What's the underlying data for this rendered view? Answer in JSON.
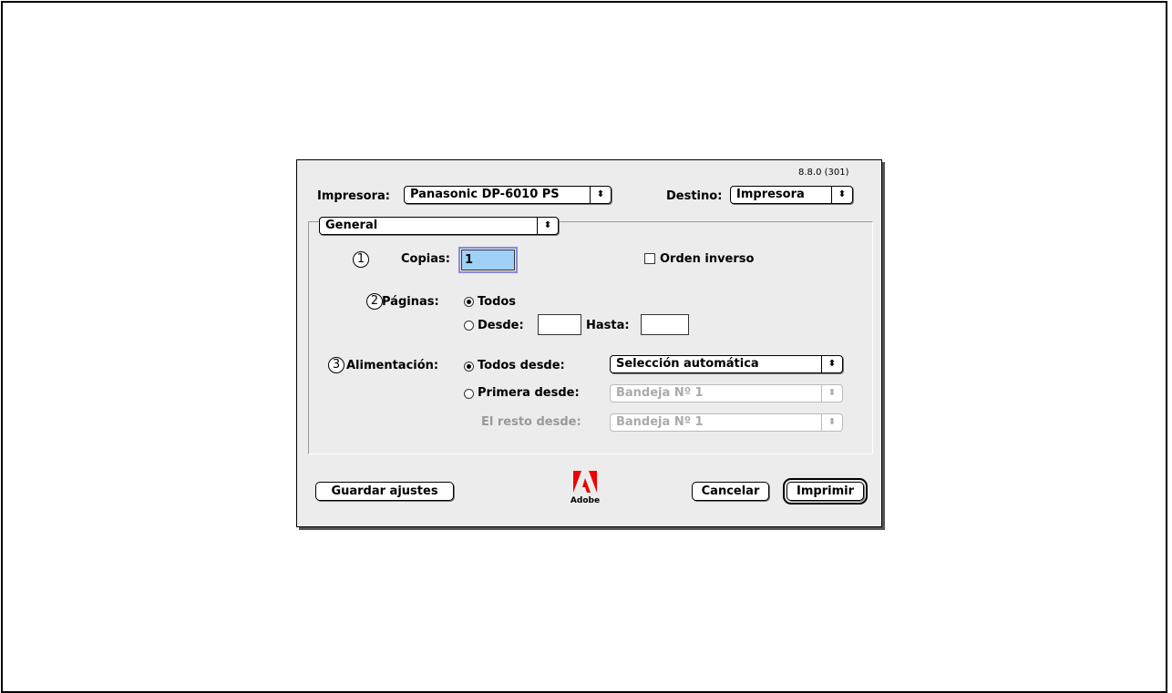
{
  "version": "8.8.0 (301)",
  "printer": {
    "label": "Impresora:",
    "value": "Panasonic DP-6010 PS"
  },
  "destination": {
    "label": "Destino:",
    "value": "Impresora"
  },
  "panel": {
    "value": "General"
  },
  "copies": {
    "number": "1",
    "label": "Copias:",
    "value": "1"
  },
  "reverse_order": {
    "label": "Orden inverso",
    "checked": false
  },
  "pages": {
    "number": "2",
    "label": "Páginas:",
    "all_label": "Todos",
    "from_label": "Desde:",
    "to_label": "Hasta:",
    "from_value": "",
    "to_value": ""
  },
  "paper_source": {
    "number": "3",
    "label": "Alimentación:",
    "all_from_label": "Todos desde:",
    "all_from_value": "Selección automática",
    "first_from_label": "Primera desde:",
    "first_from_value": "Bandeja Nº 1",
    "rest_from_label": "El resto desde:",
    "rest_from_value": "Bandeja Nº 1"
  },
  "buttons": {
    "save": "Guardar ajustes",
    "cancel": "Cancelar",
    "print": "Imprimir"
  },
  "logo": {
    "text": "Adobe"
  },
  "icons": {
    "popup_arrow": "up-down-arrows-icon",
    "logo": "adobe-logo-icon"
  }
}
